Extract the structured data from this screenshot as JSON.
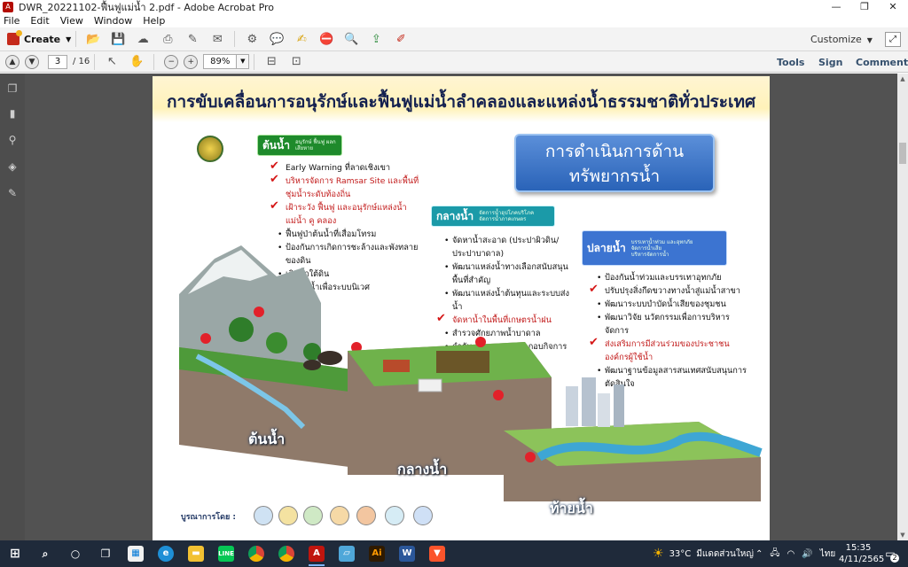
{
  "window": {
    "title": "DWR_20221102-ฟื้นฟูแม่น้ำ 2.pdf - Adobe Acrobat Pro",
    "min": "—",
    "restore": "❐",
    "close": "✕"
  },
  "menu": [
    "File",
    "Edit",
    "View",
    "Window",
    "Help"
  ],
  "toolbar": {
    "create_label": "Create",
    "customize_label": "Customize"
  },
  "nav": {
    "page_current": "3",
    "page_total": "/ 16",
    "zoom": "89%",
    "tools_label": "Tools",
    "sign_label": "Sign",
    "comment_label": "Comment"
  },
  "document": {
    "title": "การขับเคลื่อนการอนุรักษ์และฟื้นฟูแม่น้ำลำคลองและแหล่งน้ำธรรมชาติทั่วประเทศ",
    "box_line1": "การดำเนินการด้าน",
    "box_line2": "ทรัพยากรน้ำ",
    "upstream": {
      "tag": "ต้นน้ำ",
      "sub": "อนุรักษ์ ฟื้นฟู ผลกเสียหาย",
      "items": [
        {
          "text": "Early Warning ที่ลาดเชิงเขา",
          "check": true,
          "red": false
        },
        {
          "text": "บริหารจัดการ Ramsar Site และพื้นที่ชุ่มน้ำระดับท้องถิ่น",
          "check": true,
          "red": true
        },
        {
          "text": "เฝ้าระวัง ฟื้นฟู และอนุรักษ์แหล่งน้ำ แม่น้ำ คู คลอง",
          "check": true,
          "red": true
        },
        {
          "text": "ฟื้นฟูป่าต้นน้ำที่เสื่อมโทรม",
          "check": false,
          "red": false
        },
        {
          "text": "ป้องกันการเกิดการชะล้างและพังทลายของดิน",
          "check": false,
          "red": false
        },
        {
          "text": "เติมน้ำใต้ดิน",
          "check": false,
          "red": false
        },
        {
          "text": "จัดสรรน้ำเพื่อระบบนิเวศ",
          "check": false,
          "red": false
        }
      ]
    },
    "midstream": {
      "tag": "กลางน้ำ",
      "sub1": "จัดการน้ำอุปโภคบริโภค",
      "sub2": "จัดการน้ำภาคเกษตร",
      "items": [
        {
          "text": "จัดหาน้ำสะอาด (ประปาผิวดิน/ประปาบาดาล)",
          "check": false,
          "red": false
        },
        {
          "text": "พัฒนาแหล่งน้ำทางเลือกสนับสนุนพื้นที่สำคัญ",
          "check": false,
          "red": false
        },
        {
          "text": "พัฒนาแหล่งน้ำต้นทุนและระบบส่งน้ำ",
          "check": false,
          "red": false
        },
        {
          "text": "จัดหาน้ำในพื้นที่เกษตรน้ำฝน",
          "check": true,
          "red": true
        },
        {
          "text": "สำรวจศักยภาพน้ำบาดาล",
          "check": false,
          "red": false
        },
        {
          "text": "กำกับ ควบคุมการประกอบกิจการน้ำบาดาล",
          "check": false,
          "red": false
        }
      ]
    },
    "downstream": {
      "tag": "ปลายน้ำ",
      "sub1": "บรรเทาน้ำท่วม และอุทกภัย",
      "sub2": "จัดการน้ำเสีย",
      "sub3": "บริหารจัดการน้ำ",
      "items": [
        {
          "text": "ป้องกันน้ำท่วมและบรรเทาอุทกภัย",
          "check": false,
          "red": false
        },
        {
          "text": "ปรับปรุงสิ่งกีดขวางทางน้ำสู่แม่น้ำสาขา",
          "check": true,
          "red": false
        },
        {
          "text": "พัฒนาระบบบำบัดน้ำเสียของชุมชน",
          "check": false,
          "red": false
        },
        {
          "text": "พัฒนาวิจัย นวัตกรรมเพื่อการบริหารจัดการ",
          "check": false,
          "red": false
        },
        {
          "text": "ส่งเสริมการมีส่วนร่วมของประชาชน องค์กรผู้ใช้น้ำ",
          "check": true,
          "red": true
        },
        {
          "text": "พัฒนาฐานข้อมูลสารสนเทศสนับสนุนการตัดสินใจ",
          "check": false,
          "red": false
        }
      ]
    },
    "scene_label_up": "ต้นน้ำ",
    "scene_label_mid": "กลางน้ำ",
    "scene_label_down": "ท้ายน้ำ",
    "integration_label": "บูรณาการโดย :"
  },
  "taskbar": {
    "temp": "33°C",
    "weather": "มีแดดส่วนใหญ่",
    "lang": "ไทย",
    "time": "15:35",
    "date": "4/11/2565",
    "notifications": "2"
  },
  "colors": {
    "upstream_tag": "#1e8a2b",
    "midstream_tag": "#1b9aa8",
    "downstream_tag": "#3c74d1",
    "checkmark": "#d51717",
    "toolbar_link": "#35506d"
  }
}
